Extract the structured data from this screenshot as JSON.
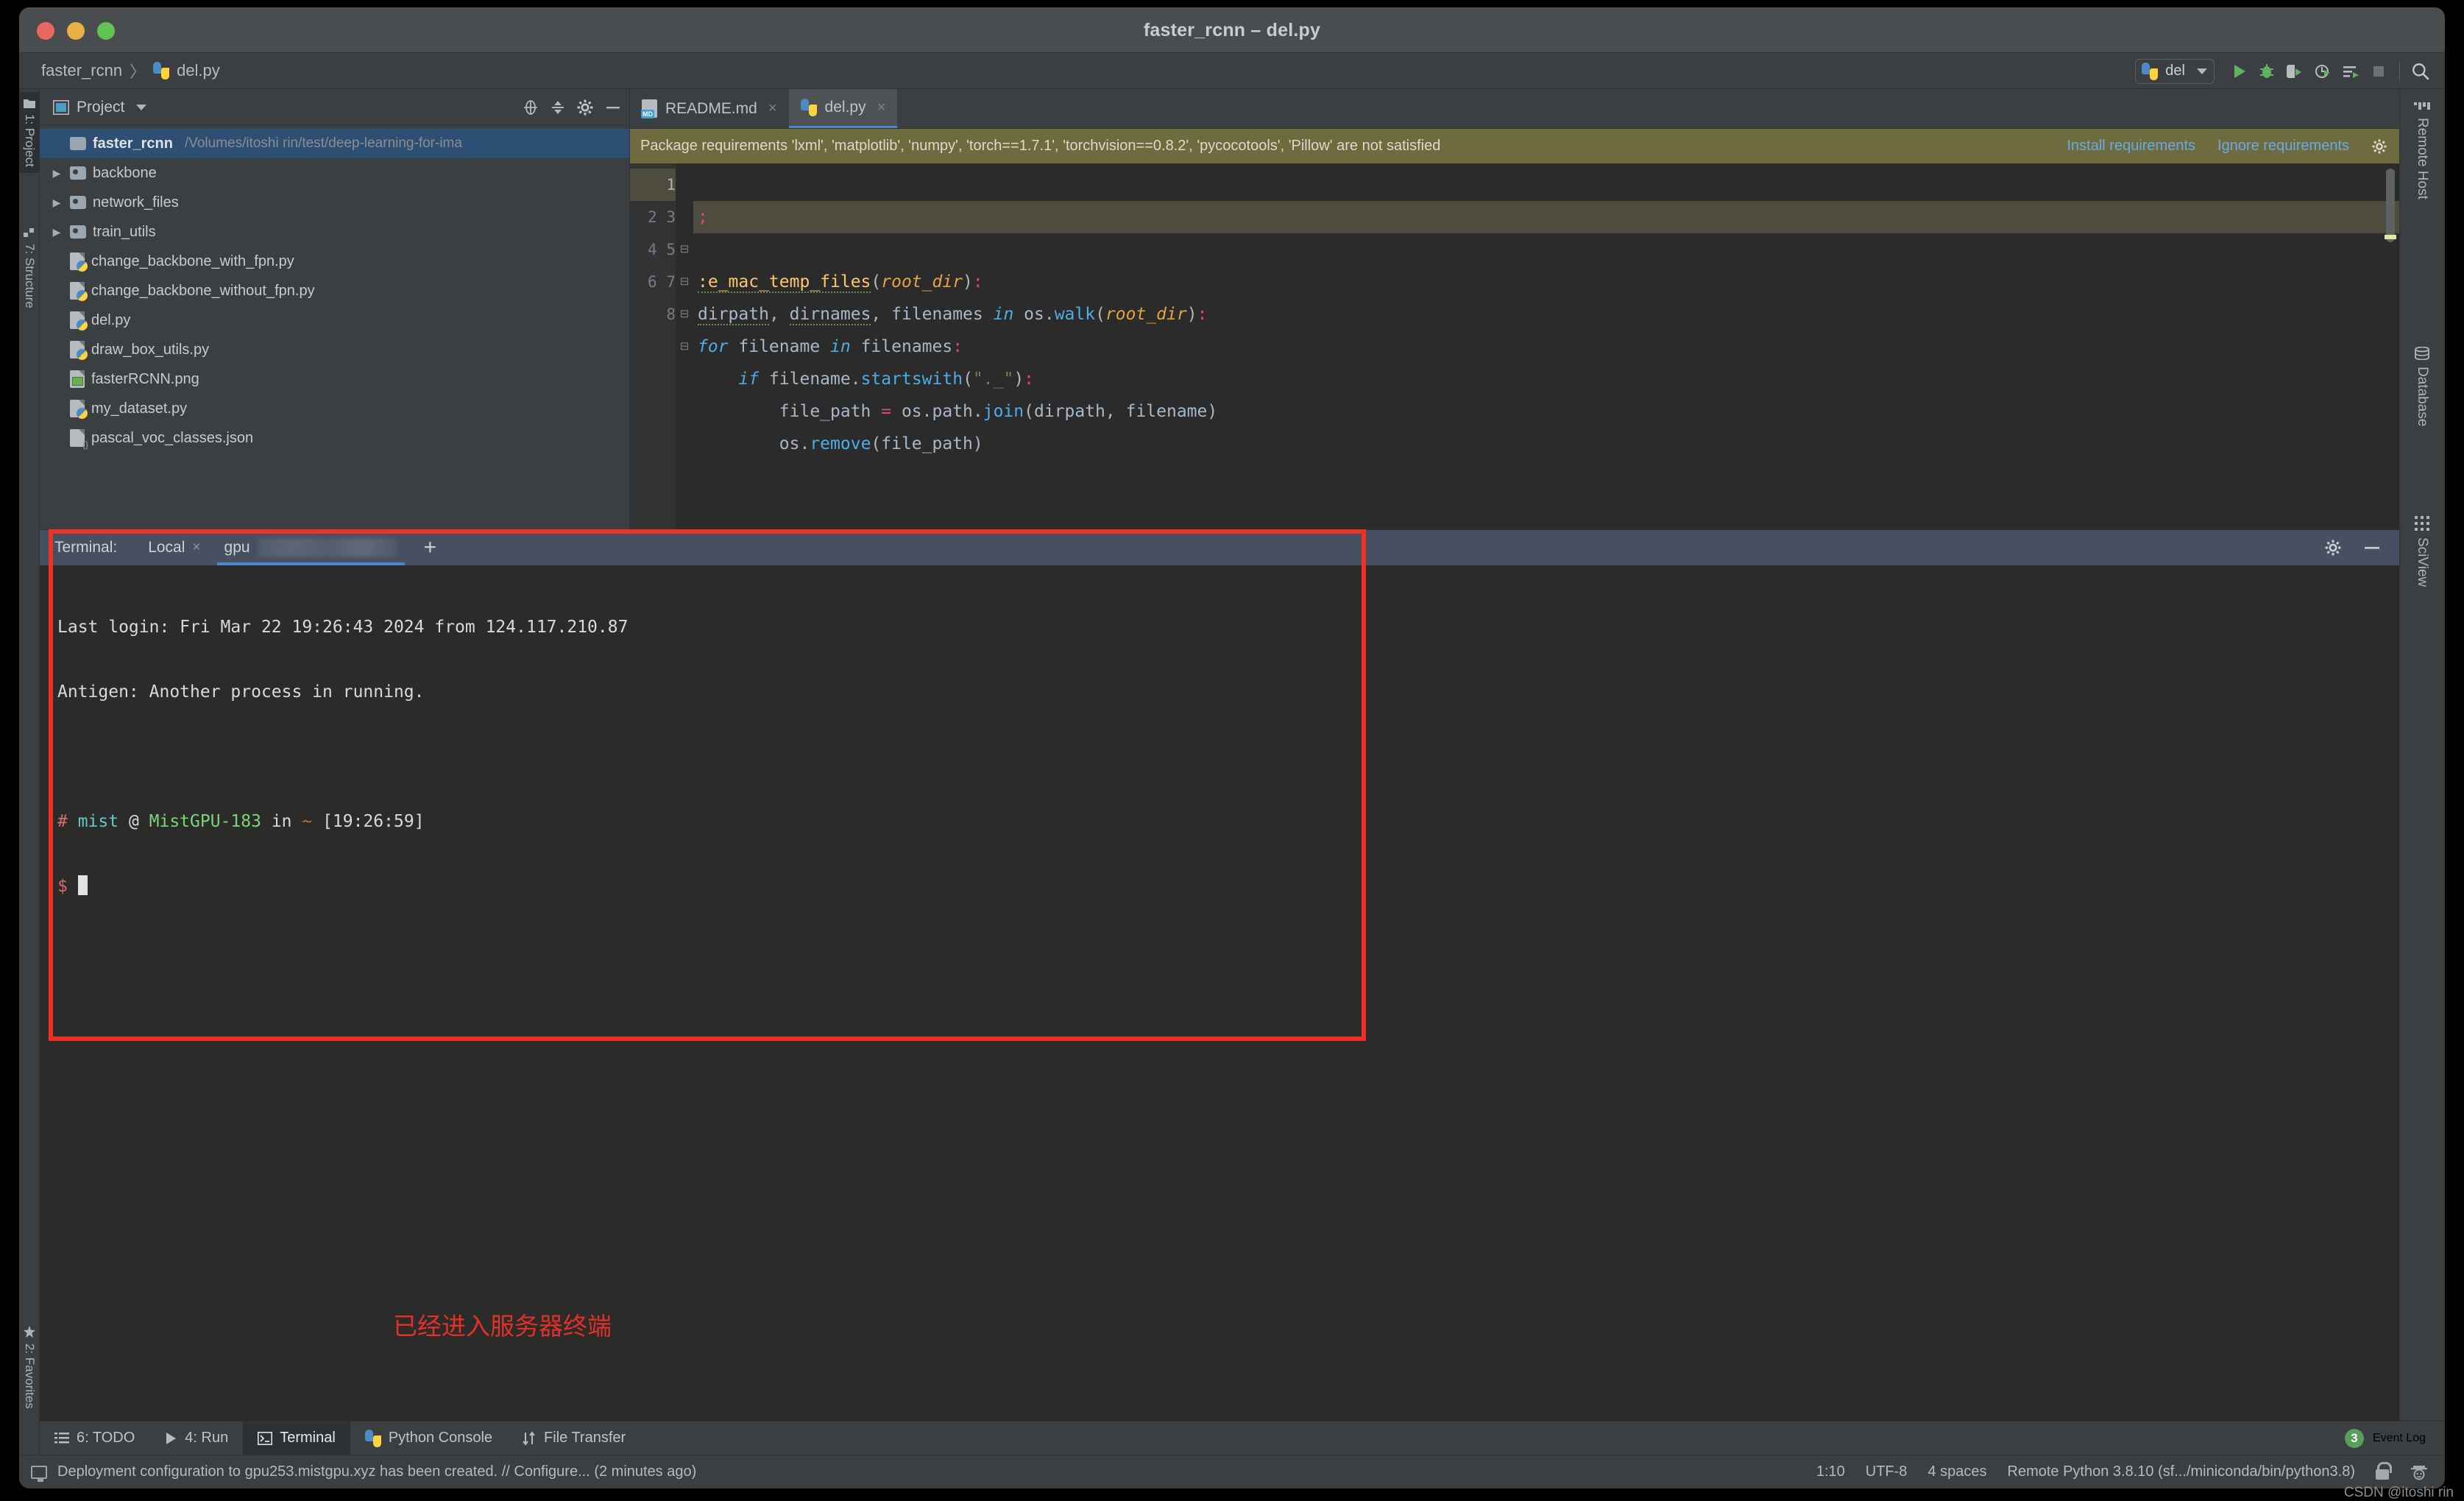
{
  "window": {
    "title": "faster_rcnn – del.py",
    "traffic_lights": [
      "close-red",
      "minimize-yellow",
      "maximize-green"
    ]
  },
  "breadcrumb": {
    "items": [
      "faster_rcnn",
      "del.py"
    ],
    "separator": "〉"
  },
  "toolbar": {
    "run_config": "del",
    "buttons": [
      {
        "name": "run-button",
        "glyph": "▶"
      },
      {
        "name": "debug-button",
        "glyph": "🐞"
      },
      {
        "name": "coverage-button",
        "glyph": "▷"
      },
      {
        "name": "profile-button",
        "glyph": "⏱"
      },
      {
        "name": "run-with-parameters-button",
        "glyph": "☰"
      },
      {
        "name": "stop-button",
        "glyph": "■"
      },
      {
        "name": "search-everywhere-button",
        "glyph": "🔍"
      }
    ]
  },
  "left_strip": {
    "tabs": [
      {
        "label": "1: Project",
        "icon": "folder-icon",
        "active": true
      },
      {
        "label": "7: Structure",
        "icon": "structure-icon",
        "active": false
      },
      {
        "label": "2: Favorites",
        "icon": "star-icon",
        "active": false
      }
    ]
  },
  "right_strip": {
    "tabs": [
      {
        "label": "Remote Host",
        "icon": "remote-host-icon"
      },
      {
        "label": "Database",
        "icon": "database-icon"
      },
      {
        "label": "SciView",
        "icon": "sciview-icon"
      }
    ]
  },
  "project_panel": {
    "title": "Project",
    "actions": [
      "locate-icon",
      "collapse-all-icon",
      "settings-icon",
      "hide-icon"
    ],
    "tree": [
      {
        "name": "faster_rcnn",
        "path": "/Volumes/itoshi rin/test/deep-learning-for-ima",
        "type": "root",
        "selected": true,
        "arrow": ""
      },
      {
        "name": "backbone",
        "type": "folder",
        "arrow": "▶"
      },
      {
        "name": "network_files",
        "type": "folder",
        "arrow": "▶"
      },
      {
        "name": "train_utils",
        "type": "folder",
        "arrow": "▶"
      },
      {
        "name": "change_backbone_with_fpn.py",
        "type": "python",
        "arrow": ""
      },
      {
        "name": "change_backbone_without_fpn.py",
        "type": "python",
        "arrow": ""
      },
      {
        "name": "del.py",
        "type": "python",
        "arrow": ""
      },
      {
        "name": "draw_box_utils.py",
        "type": "python",
        "arrow": ""
      },
      {
        "name": "fasterRCNN.png",
        "type": "image",
        "arrow": ""
      },
      {
        "name": "my_dataset.py",
        "type": "python",
        "arrow": ""
      },
      {
        "name": "pascal_voc_classes.json",
        "type": "json",
        "arrow": ""
      }
    ]
  },
  "editor": {
    "tabs": [
      {
        "label": "README.md",
        "icon": "markdown-icon",
        "active": false
      },
      {
        "label": "del.py",
        "icon": "python-icon",
        "active": true
      }
    ],
    "close_glyph": "×",
    "notification": {
      "message": "Package requirements 'lxml', 'matplotlib', 'numpy', 'torch==1.7.1', 'torchvision==0.8.2', 'pycocotools', 'Pillow' are not satisfied",
      "install_link": "Install requirements",
      "ignore_link": "Ignore requirements",
      "settings_icon": "gear-icon"
    },
    "line_numbers": [
      "1",
      "2",
      "3",
      "4",
      "5",
      "6",
      "7",
      "8"
    ],
    "code_lines": [
      {
        "n": "1",
        "text": ";",
        "current": true
      },
      {
        "n": "2",
        "text": ""
      },
      {
        "n": "3",
        "text": ":e_mac_temp_files(root_dir):"
      },
      {
        "n": "4",
        "text": "dirpath, dirnames, filenames in os.walk(root_dir):"
      },
      {
        "n": "5",
        "text": "for filename in filenames:"
      },
      {
        "n": "6",
        "text": "    if filename.startswith(\"._\"):"
      },
      {
        "n": "7",
        "text": "        file_path = os.path.join(dirpath, filename)"
      },
      {
        "n": "8",
        "text": "        os.remove(file_path)"
      }
    ]
  },
  "terminal": {
    "header_label": "Terminal:",
    "tabs": [
      {
        "label": "Local",
        "active": false,
        "closable": true
      },
      {
        "label": "gpu",
        "active": true,
        "redacted": true
      }
    ],
    "add_glyph": "+",
    "header_actions": [
      "gear-icon",
      "minimize-icon"
    ],
    "lines": [
      {
        "segments": [
          {
            "t": "Last login: Fri Mar 22 19:26:43 2024 from 124.117.210.87",
            "c": "default"
          }
        ]
      },
      {
        "segments": [
          {
            "t": "Antigen: Another process in running.",
            "c": "default"
          }
        ]
      },
      {
        "segments": [
          {
            "t": "",
            "c": "default"
          }
        ]
      },
      {
        "segments": [
          {
            "t": "# ",
            "c": "red"
          },
          {
            "t": "mist",
            "c": "cyan"
          },
          {
            "t": " @ ",
            "c": "default"
          },
          {
            "t": "MistGPU-183",
            "c": "green"
          },
          {
            "t": " in ",
            "c": "default"
          },
          {
            "t": "~",
            "c": "orange"
          },
          {
            "t": " [19:26:59]",
            "c": "default"
          }
        ]
      },
      {
        "segments": [
          {
            "t": "$ ",
            "c": "red"
          }
        ],
        "cursor": true
      }
    ]
  },
  "annotation": {
    "text": "已经进入服务器终端",
    "color": "#e33028",
    "box_color": "#ee3124"
  },
  "bottom_bar": {
    "tabs": [
      {
        "label": "6: TODO",
        "icon": "todo-icon",
        "active": false
      },
      {
        "label": "4: Run",
        "icon": "run-icon",
        "active": false
      },
      {
        "label": "Terminal",
        "icon": "terminal-icon",
        "active": true
      },
      {
        "label": "Python Console",
        "icon": "python-icon",
        "active": false
      },
      {
        "label": "File Transfer",
        "icon": "file-transfer-icon",
        "active": false
      }
    ],
    "event_log": {
      "label": "Event Log",
      "count": "3"
    }
  },
  "status_bar": {
    "message": "Deployment configuration to gpu253.mistgpu.xyz has been created. // Configure... (2 minutes ago)",
    "caret_position": "1:10",
    "encoding": "UTF-8",
    "indent": "4 spaces",
    "interpreter": "Remote Python 3.8.10 (sf.../miniconda/bin/python3.8)",
    "icons": [
      "lock-icon",
      "inspector-icon"
    ]
  },
  "watermark": "CSDN @itoshi rin"
}
